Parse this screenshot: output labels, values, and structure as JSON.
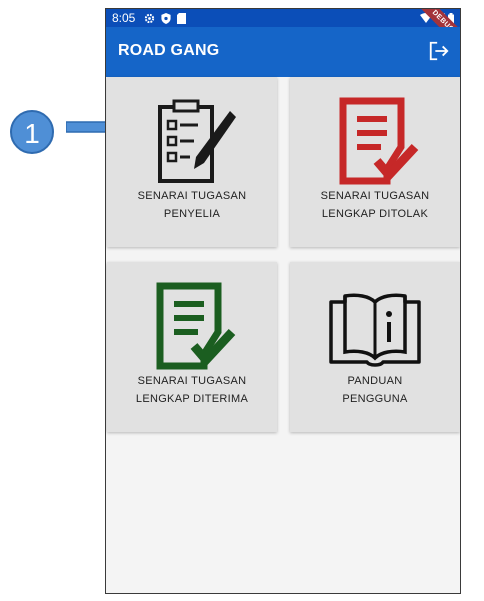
{
  "callout": {
    "number": "1"
  },
  "status_bar": {
    "time": "8:05",
    "left_icons": [
      "gear-icon",
      "shield-icon",
      "sd-card-icon"
    ],
    "right_icons": [
      "wifi-icon",
      "signal-icon",
      "battery-icon"
    ]
  },
  "debug_ribbon": "DEBUG",
  "app_bar": {
    "title": "ROAD GANG",
    "action_icon": "logout-icon"
  },
  "tiles": [
    {
      "line1": "SENARAI TUGASAN",
      "line2": "PENYELIA",
      "icon": "clipboard-pencil-icon",
      "color": "#1a1a1a"
    },
    {
      "line1": "SENARAI TUGASAN",
      "line2": "LENGKAP DITOLAK",
      "icon": "document-check-red-icon",
      "color": "#c62828"
    },
    {
      "line1": "SENARAI TUGASAN",
      "line2": "LENGKAP DITERIMA",
      "icon": "document-check-green-icon",
      "color": "#1b5e20"
    },
    {
      "line1": "PANDUAN",
      "line2": "PENGGUNA",
      "icon": "open-book-info-icon",
      "color": "#111111"
    }
  ],
  "colors": {
    "status_bar": "#0b4eb8",
    "app_bar": "#1565c8",
    "tile_bg": "#e1e1e1",
    "callout": "#4f8fd6"
  }
}
